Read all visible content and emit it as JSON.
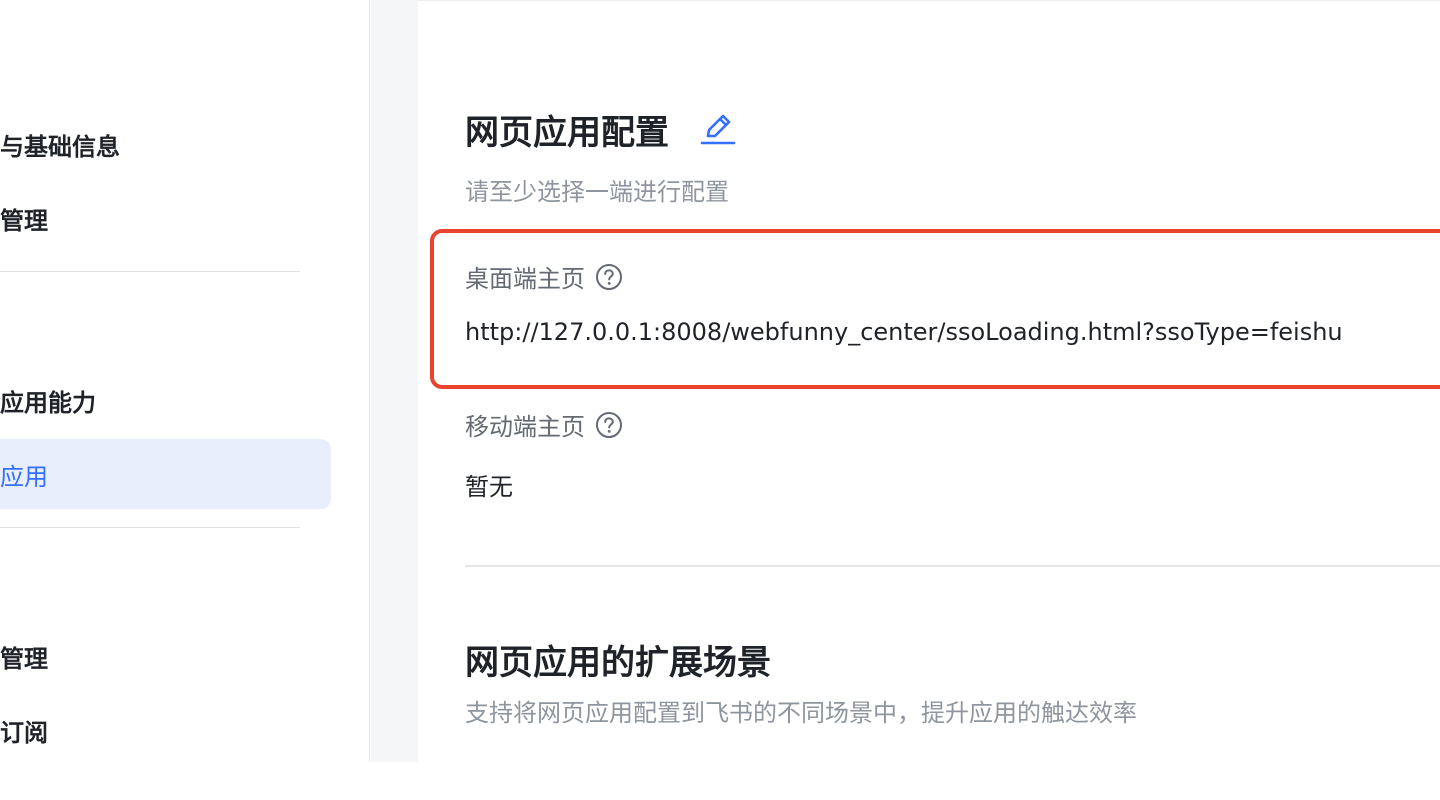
{
  "sidebar": {
    "items": [
      {
        "label": "与基础信息"
      },
      {
        "label": "管理"
      },
      {
        "label": "应用能力"
      },
      {
        "label": "应用"
      },
      {
        "label": "管理"
      },
      {
        "label": "订阅"
      }
    ],
    "active_index": 3
  },
  "web_app_config": {
    "title": "网页应用配置",
    "description": "请至少选择一端进行配置",
    "desktop_home": {
      "label": "桌面端主页",
      "value": "http://127.0.0.1:8008/webfunny_center/ssoLoading.html?ssoType=feishu"
    },
    "mobile_home": {
      "label": "移动端主页",
      "value": "暂无"
    }
  },
  "extension_scenes": {
    "title": "网页应用的扩展场景",
    "description": "支持将网页应用配置到飞书的不同场景中，提升应用的触达效率"
  },
  "colors": {
    "accent": "#3370ff",
    "highlight_border": "#e8442e",
    "active_bg": "#e8eefc"
  },
  "icons": [
    "edit-icon",
    "help-circle-icon"
  ]
}
